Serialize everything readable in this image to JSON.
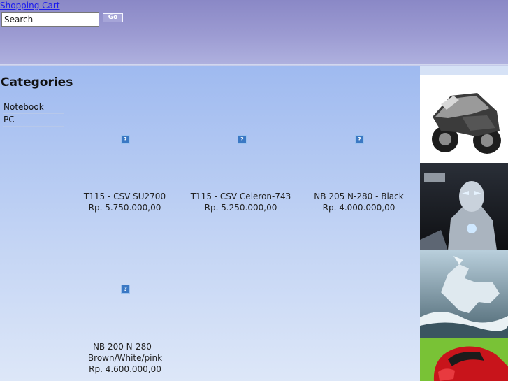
{
  "header": {
    "cart_link": "Shopping Cart",
    "search_value": "Search",
    "go_label": "Go"
  },
  "sidebar": {
    "title": "Categories",
    "items": [
      {
        "label": "Notebook"
      },
      {
        "label": "PC"
      }
    ]
  },
  "products": [
    {
      "name": "T115 - CSV SU2700",
      "price": "Rp. 5.750.000,00",
      "icon": "broken-image-icon"
    },
    {
      "name": "T115 - CSV Celeron-743",
      "price": "Rp. 5.250.000,00",
      "icon": "broken-image-icon"
    },
    {
      "name": "NB 205 N-280 - Black",
      "price": "Rp. 4.000.000,00",
      "icon": "broken-image-icon"
    },
    {
      "name": "NB 200 N-280 - Brown/White/pink",
      "price": "Rp. 4.600.000,00",
      "icon": "broken-image-icon"
    }
  ],
  "side_images": [
    {
      "subject": "motorcycle"
    },
    {
      "subject": "armored-robot"
    },
    {
      "subject": "crystal-horse"
    },
    {
      "subject": "red-car-on-green"
    }
  ],
  "colors": {
    "header": "#9c9bd2",
    "content_top": "#9fbaf0",
    "content_bottom": "#dde7f8",
    "link": "#1a1aee"
  }
}
